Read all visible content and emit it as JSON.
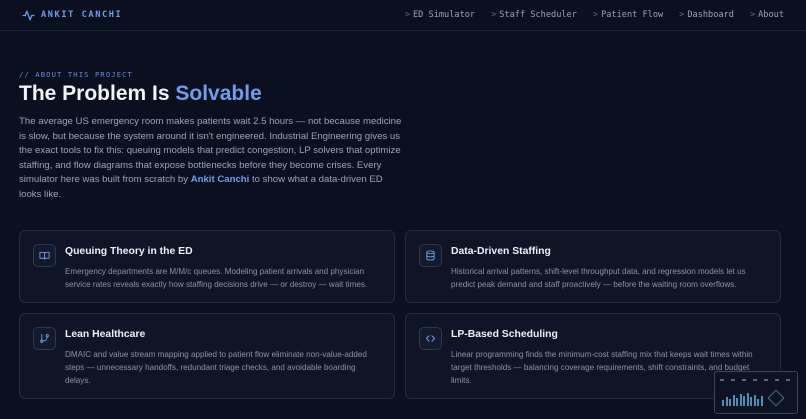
{
  "nav": {
    "brand": "ANKIT CANCHI",
    "links": [
      {
        "label": "ED Simulator"
      },
      {
        "label": "Staff Scheduler"
      },
      {
        "label": "Patient Flow"
      },
      {
        "label": "Dashboard"
      },
      {
        "label": "About"
      }
    ]
  },
  "hero": {
    "kicker": "// ABOUT THIS PROJECT",
    "title_main": "The Problem Is ",
    "title_accent": "Solvable",
    "intro_before": "The average US emergency room makes patients wait 2.5 hours — not because medicine is slow, but because the system around it isn't engineered. Industrial Engineering gives us the exact tools to fix this: queuing models that predict congestion, LP solvers that optimize staffing, and flow diagrams that expose bottlenecks before they become crises. Every simulator here was built from scratch by ",
    "intro_author": "Ankit Canchi",
    "intro_after": " to show what a data-driven ED looks like."
  },
  "cards": [
    {
      "icon": "book-icon",
      "title": "Queuing Theory in the ED",
      "body": "Emergency departments are M/M/c queues. Modeling patient arrivals and physician service rates reveals exactly how staffing decisions drive — or destroy — wait times."
    },
    {
      "icon": "database-icon",
      "title": "Data-Driven Staffing",
      "body": "Historical arrival patterns, shift-level throughput data, and regression models let us predict peak demand and staff proactively — before the waiting room overflows."
    },
    {
      "icon": "git-branch-icon",
      "title": "Lean Healthcare",
      "body": "DMAIC and value stream mapping applied to patient flow eliminate non-value-added steps — unnecessary handoffs, redundant triage checks, and avoidable boarding delays."
    },
    {
      "icon": "code-icon",
      "title": "LP-Based Scheduling",
      "body": "Linear programming finds the minimum-cost staffing mix that keeps wait times within target thresholds — balancing coverage requirements, shift constraints, and budget limits."
    }
  ],
  "colors": {
    "background": "#0b1020",
    "accent": "#6f9ee8",
    "card": "#0f1526"
  }
}
